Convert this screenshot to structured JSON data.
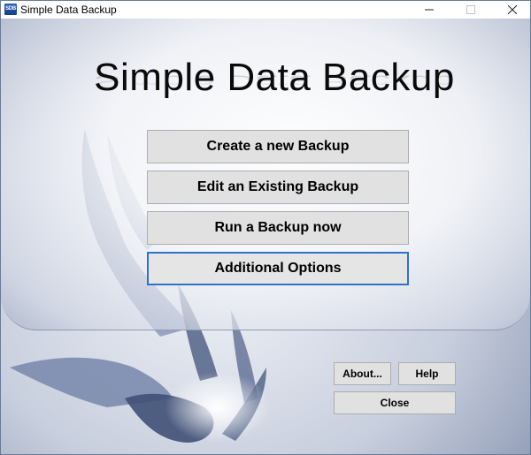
{
  "window": {
    "title": "Simple Data Backup",
    "icon_label": "SDB",
    "controls": {
      "minimize": "minimize-icon",
      "maximize": "maximize-icon",
      "close": "close-icon"
    }
  },
  "header": {
    "title": "Simple Data Backup"
  },
  "menu": {
    "create": "Create a new Backup",
    "edit": "Edit an Existing Backup",
    "run": "Run a Backup now",
    "options": "Additional Options"
  },
  "footer": {
    "about": "About...",
    "help": "Help",
    "close": "Close"
  },
  "colors": {
    "accent": "#2f72c9",
    "button_face": "#e1e1e1",
    "background_art": "#7d8aa8"
  }
}
